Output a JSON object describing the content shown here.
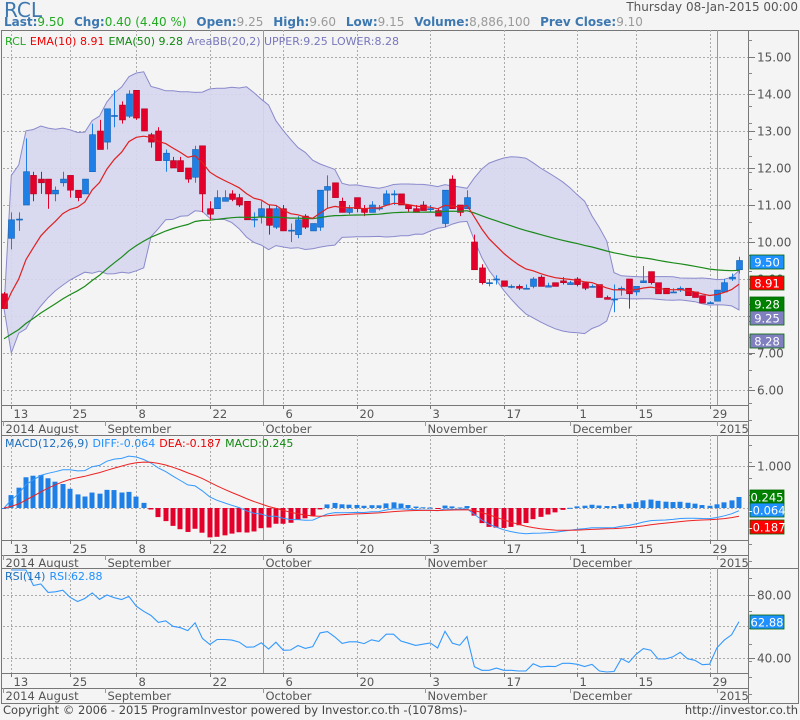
{
  "header": {
    "symbol": "RCL",
    "datetime": "Thursday 08-Jan-2015 00:00",
    "stats": [
      {
        "label": "Last:",
        "value": "9.50",
        "highlight": true
      },
      {
        "label": "Chg:",
        "value": "0.40 (4.40 %)",
        "highlight": true
      },
      {
        "label": "Open:",
        "value": "9.25",
        "highlight": false
      },
      {
        "label": "High:",
        "value": "9.60",
        "highlight": false
      },
      {
        "label": "Low:",
        "value": "9.15",
        "highlight": false
      },
      {
        "label": "Volume:",
        "value": "8,886,100",
        "highlight": false
      },
      {
        "label": "Prev Close:",
        "value": "9.10",
        "highlight": false
      }
    ]
  },
  "footer": {
    "copyright": "Copyright © 2006 - 2015 ProgramInvestor powered by Investor.co.th -(1078ms)-",
    "url": "http://investor.co.th"
  },
  "colors": {
    "up": "#1e7fe6",
    "down": "#e3002b",
    "ema10": "#e02020",
    "ema50": "#1a8a1a",
    "bb_fill": "#d6d6ee",
    "bb_line": "#8a8acc",
    "macd_diff": "#3399ff",
    "macd_dea": "#ee2222",
    "rsi": "#3399ff"
  },
  "chart_data": [
    {
      "type": "candlestick",
      "title": "RCL",
      "legend": {
        "symbol": "RCL",
        "ema10": "EMA(10) 8.91",
        "ema50": "EMA(50) 9.28",
        "bb": "AreaBB(20,2) UPPER:9.25 LOWER:8.28"
      },
      "ylim": [
        5.5,
        15.6
      ],
      "yticks": [
        "15.00",
        "14.00",
        "13.00",
        "12.00",
        "11.00",
        "10.00",
        "9.00",
        "8.00",
        "7.00",
        "6.00"
      ],
      "ytick_values": [
        15,
        14,
        13,
        12,
        11,
        10,
        9,
        8,
        7,
        6
      ],
      "value_tags": [
        {
          "label": "9.50",
          "value": 9.5,
          "color": "#1e90ff"
        },
        {
          "label": "8.91",
          "value": 8.91,
          "color": "#ff0000"
        },
        {
          "label": "9.28",
          "value": 9.28,
          "color": "#008000"
        },
        {
          "label": "9.25",
          "value": 9.25,
          "color": "#8080c0"
        },
        {
          "label": "8.28",
          "value": 8.28,
          "color": "#8080c0"
        }
      ],
      "ema50_start": 7.35,
      "candles_ohlc": [
        [
          8.6,
          8.65,
          8.2,
          8.2
        ],
        [
          10.1,
          10.8,
          9.8,
          10.6
        ],
        [
          10.6,
          10.8,
          10.3,
          10.62
        ],
        [
          11.0,
          12.8,
          11.0,
          11.9
        ],
        [
          11.8,
          11.9,
          11.1,
          11.3
        ],
        [
          11.7,
          11.9,
          11.3,
          11.6
        ],
        [
          11.7,
          11.7,
          10.9,
          11.3
        ],
        [
          11.3,
          11.5,
          11.1,
          11.4
        ],
        [
          11.6,
          11.9,
          11.5,
          11.7
        ],
        [
          11.8,
          11.8,
          11.2,
          11.4
        ],
        [
          11.4,
          11.4,
          11.1,
          11.2
        ],
        [
          11.3,
          11.7,
          11.3,
          11.7
        ],
        [
          11.9,
          13.2,
          11.9,
          12.9
        ],
        [
          13.0,
          13.3,
          12.5,
          12.5
        ],
        [
          12.7,
          13.6,
          12.5,
          13.6
        ],
        [
          13.4,
          14.1,
          13.1,
          13.42
        ],
        [
          13.7,
          13.8,
          13.2,
          13.3
        ],
        [
          13.4,
          14.1,
          13.35,
          14.0
        ],
        [
          14.1,
          14.1,
          13.3,
          13.35
        ],
        [
          13.6,
          13.6,
          13.0,
          13.0
        ],
        [
          12.9,
          12.95,
          12.55,
          12.7
        ],
        [
          13.0,
          13.1,
          12.2,
          12.2
        ],
        [
          12.2,
          12.5,
          11.9,
          12.4
        ],
        [
          12.2,
          12.3,
          12.0,
          12.0
        ],
        [
          12.2,
          12.3,
          11.9,
          11.9
        ],
        [
          12.0,
          12.0,
          11.6,
          11.7
        ],
        [
          11.75,
          12.6,
          11.6,
          12.5
        ],
        [
          12.6,
          12.6,
          10.8,
          11.3
        ],
        [
          10.9,
          11.1,
          10.6,
          10.75
        ],
        [
          10.9,
          11.4,
          10.9,
          11.2
        ],
        [
          11.1,
          11.4,
          11.1,
          11.2
        ],
        [
          11.3,
          11.4,
          11.1,
          11.15
        ],
        [
          11.2,
          11.3,
          10.95,
          11.0
        ],
        [
          11.1,
          11.1,
          10.6,
          10.6
        ],
        [
          10.6,
          10.8,
          10.4,
          10.62
        ],
        [
          10.7,
          11.1,
          10.5,
          10.9
        ],
        [
          10.9,
          11.0,
          10.2,
          10.45
        ],
        [
          10.4,
          11.0,
          10.35,
          10.9
        ],
        [
          10.9,
          11.0,
          10.3,
          10.3
        ],
        [
          10.3,
          10.5,
          10.0,
          10.32
        ],
        [
          10.2,
          10.7,
          10.1,
          10.6
        ],
        [
          10.7,
          10.75,
          10.35,
          10.4
        ],
        [
          10.3,
          10.5,
          10.3,
          10.5
        ],
        [
          10.4,
          11.4,
          10.3,
          11.4
        ],
        [
          11.4,
          11.8,
          10.9,
          11.5
        ],
        [
          11.6,
          11.6,
          11.2,
          11.2
        ],
        [
          11.1,
          11.2,
          10.8,
          10.8
        ],
        [
          10.8,
          11.0,
          10.75,
          10.9
        ],
        [
          11.2,
          11.2,
          10.8,
          10.9
        ],
        [
          10.9,
          11.0,
          10.7,
          10.8
        ],
        [
          10.8,
          11.1,
          10.8,
          11.0
        ],
        [
          10.9,
          11.0,
          10.85,
          10.92
        ],
        [
          11.0,
          11.4,
          11.0,
          11.3
        ],
        [
          11.3,
          11.4,
          11.0,
          11.3
        ],
        [
          11.3,
          11.3,
          11.0,
          11.0
        ],
        [
          11.0,
          11.0,
          10.8,
          10.9
        ],
        [
          10.9,
          11.0,
          10.8,
          10.8
        ],
        [
          11.0,
          11.1,
          10.85,
          10.85
        ],
        [
          10.9,
          11.0,
          10.8,
          10.9
        ],
        [
          10.85,
          10.9,
          10.7,
          10.7
        ],
        [
          10.5,
          11.4,
          10.4,
          11.4
        ],
        [
          11.7,
          11.8,
          10.9,
          10.9
        ],
        [
          11.0,
          11.0,
          10.7,
          10.8
        ],
        [
          10.9,
          11.4,
          10.9,
          11.2
        ],
        [
          10.0,
          10.2,
          9.25,
          9.25
        ],
        [
          9.3,
          9.4,
          8.85,
          8.9
        ],
        [
          8.9,
          9.0,
          8.8,
          8.9
        ],
        [
          9.0,
          9.1,
          8.85,
          9.0
        ],
        [
          8.95,
          8.95,
          8.8,
          8.8
        ],
        [
          8.8,
          8.85,
          8.75,
          8.8
        ],
        [
          8.8,
          8.85,
          8.7,
          8.75
        ],
        [
          8.75,
          8.85,
          8.75,
          8.75
        ],
        [
          8.8,
          9.05,
          8.75,
          9.0
        ],
        [
          9.05,
          9.1,
          8.8,
          8.8
        ],
        [
          8.78,
          8.9,
          8.78,
          8.82
        ],
        [
          8.9,
          8.9,
          8.8,
          8.8
        ],
        [
          8.95,
          9.05,
          8.85,
          8.9
        ],
        [
          8.85,
          8.95,
          8.85,
          8.9
        ],
        [
          9.0,
          9.05,
          8.8,
          8.85
        ],
        [
          8.9,
          8.9,
          8.7,
          8.75
        ],
        [
          8.8,
          8.85,
          8.8,
          8.8
        ],
        [
          8.85,
          8.85,
          8.5,
          8.5
        ],
        [
          8.5,
          8.55,
          8.45,
          8.45
        ],
        [
          8.45,
          8.85,
          8.1,
          8.46
        ],
        [
          8.7,
          8.8,
          8.55,
          8.75
        ],
        [
          9.0,
          9.0,
          8.2,
          8.6
        ],
        [
          8.65,
          8.8,
          8.55,
          8.8
        ],
        [
          8.9,
          9.35,
          8.9,
          8.95
        ],
        [
          9.2,
          9.2,
          8.85,
          8.9
        ],
        [
          8.9,
          8.9,
          8.6,
          8.6
        ],
        [
          8.75,
          8.75,
          8.6,
          8.6
        ],
        [
          8.65,
          8.75,
          8.65,
          8.65
        ],
        [
          8.7,
          8.8,
          8.65,
          8.75
        ],
        [
          8.75,
          8.75,
          8.55,
          8.55
        ],
        [
          8.65,
          8.65,
          8.5,
          8.5
        ],
        [
          8.55,
          8.55,
          8.35,
          8.35
        ],
        [
          8.35,
          8.4,
          8.35,
          8.36
        ],
        [
          8.4,
          8.7,
          8.4,
          8.7
        ],
        [
          8.65,
          9.0,
          8.65,
          8.9
        ],
        [
          9.0,
          9.15,
          8.95,
          9.05
        ],
        [
          9.25,
          9.6,
          9.15,
          9.5
        ]
      ],
      "x_day_ticks": [
        {
          "label": "13",
          "index": 1
        },
        {
          "label": "25",
          "index": 9
        },
        {
          "label": "8",
          "index": 18
        },
        {
          "label": "22",
          "index": 28
        },
        {
          "label": "6",
          "index": 38
        },
        {
          "label": "20",
          "index": 48
        },
        {
          "label": "3",
          "index": 58
        },
        {
          "label": "17",
          "index": 68
        },
        {
          "label": "1",
          "index": 78
        },
        {
          "label": "15",
          "index": 86
        },
        {
          "label": "29",
          "index": 96
        }
      ],
      "x_months": [
        {
          "label": "2014 August",
          "start_index": -0.5
        },
        {
          "label": "September",
          "start_index": 13.7
        },
        {
          "label": "October",
          "start_index": 35.2
        },
        {
          "label": "November",
          "start_index": 57.3
        },
        {
          "label": "December",
          "start_index": 77.0
        },
        {
          "label": "2015",
          "start_index": 97.0
        }
      ],
      "quarter_start_indices": [
        35.2,
        97.0
      ]
    },
    {
      "type": "line",
      "title": "MACD(12,26,9)",
      "legend": {
        "name": "MACD(12,26,9)",
        "diff": "DIFF:-0.064",
        "dea": "DEA:-0.187",
        "macd": "MACD:0.245"
      },
      "series": [
        {
          "name": "DIFF",
          "last": -0.064
        },
        {
          "name": "DEA",
          "last": -0.187
        },
        {
          "name": "MACD",
          "last": 0.245,
          "kind": "histogram"
        }
      ],
      "yticks": [
        "1.000"
      ],
      "ytick_values": [
        1.0
      ],
      "value_tags": [
        {
          "label": "0.245",
          "value": 0.245,
          "color": "#008000"
        },
        {
          "label": "-0.064",
          "value": -0.064,
          "color": "#1e90ff"
        },
        {
          "label": "-0.187",
          "value": -0.187,
          "color": "#ff0000"
        }
      ]
    },
    {
      "type": "line",
      "title": "RSI(14)",
      "legend": {
        "name": "RSI(14)",
        "value": "RSI:62.88"
      },
      "last": 62.88,
      "yticks": [
        "80.00",
        "40.00"
      ],
      "ytick_values": [
        80,
        40
      ],
      "value_tags": [
        {
          "label": "62.88",
          "value": 62.88,
          "color": "#1e90ff"
        }
      ]
    }
  ]
}
